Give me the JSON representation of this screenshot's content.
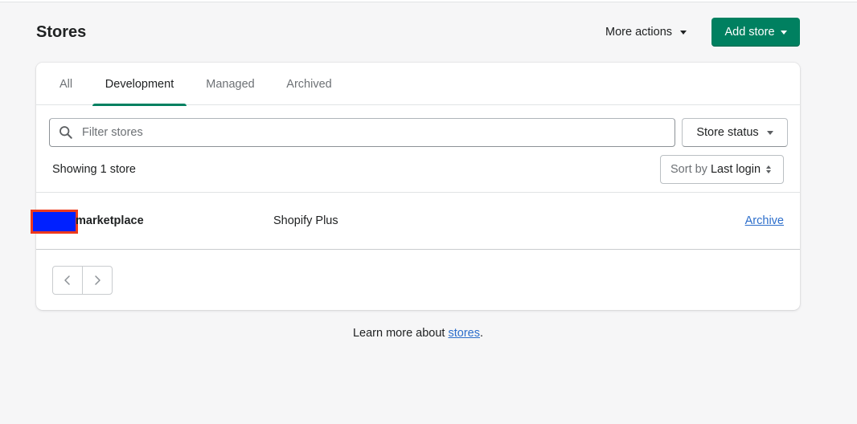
{
  "header": {
    "title": "Stores",
    "more_actions_label": "More actions",
    "add_store_label": "Add store"
  },
  "tabs": [
    {
      "label": "All"
    },
    {
      "label": "Development",
      "active": true
    },
    {
      "label": "Managed"
    },
    {
      "label": "Archived"
    }
  ],
  "filter": {
    "placeholder": "Filter stores",
    "value": "",
    "status_button_label": "Store status"
  },
  "results": {
    "showing_text": "Showing 1 store",
    "sort_prefix": "Sort by",
    "sort_value": "Last login"
  },
  "stores": [
    {
      "name": "marketplace",
      "plan": "Shopify Plus",
      "action": "Archive"
    }
  ],
  "footer": {
    "prefix": "Learn more about ",
    "link": "stores",
    "suffix": "."
  },
  "colors": {
    "primary": "#008060",
    "link": "#2c6ecb",
    "redaction_fill": "#0020ff",
    "redaction_border": "#ee3a1c"
  },
  "icons": {
    "search": "search-icon",
    "caret": "caret-down-icon",
    "sort": "sort-updown-icon",
    "prev": "chevron-left-icon",
    "next": "chevron-right-icon"
  }
}
